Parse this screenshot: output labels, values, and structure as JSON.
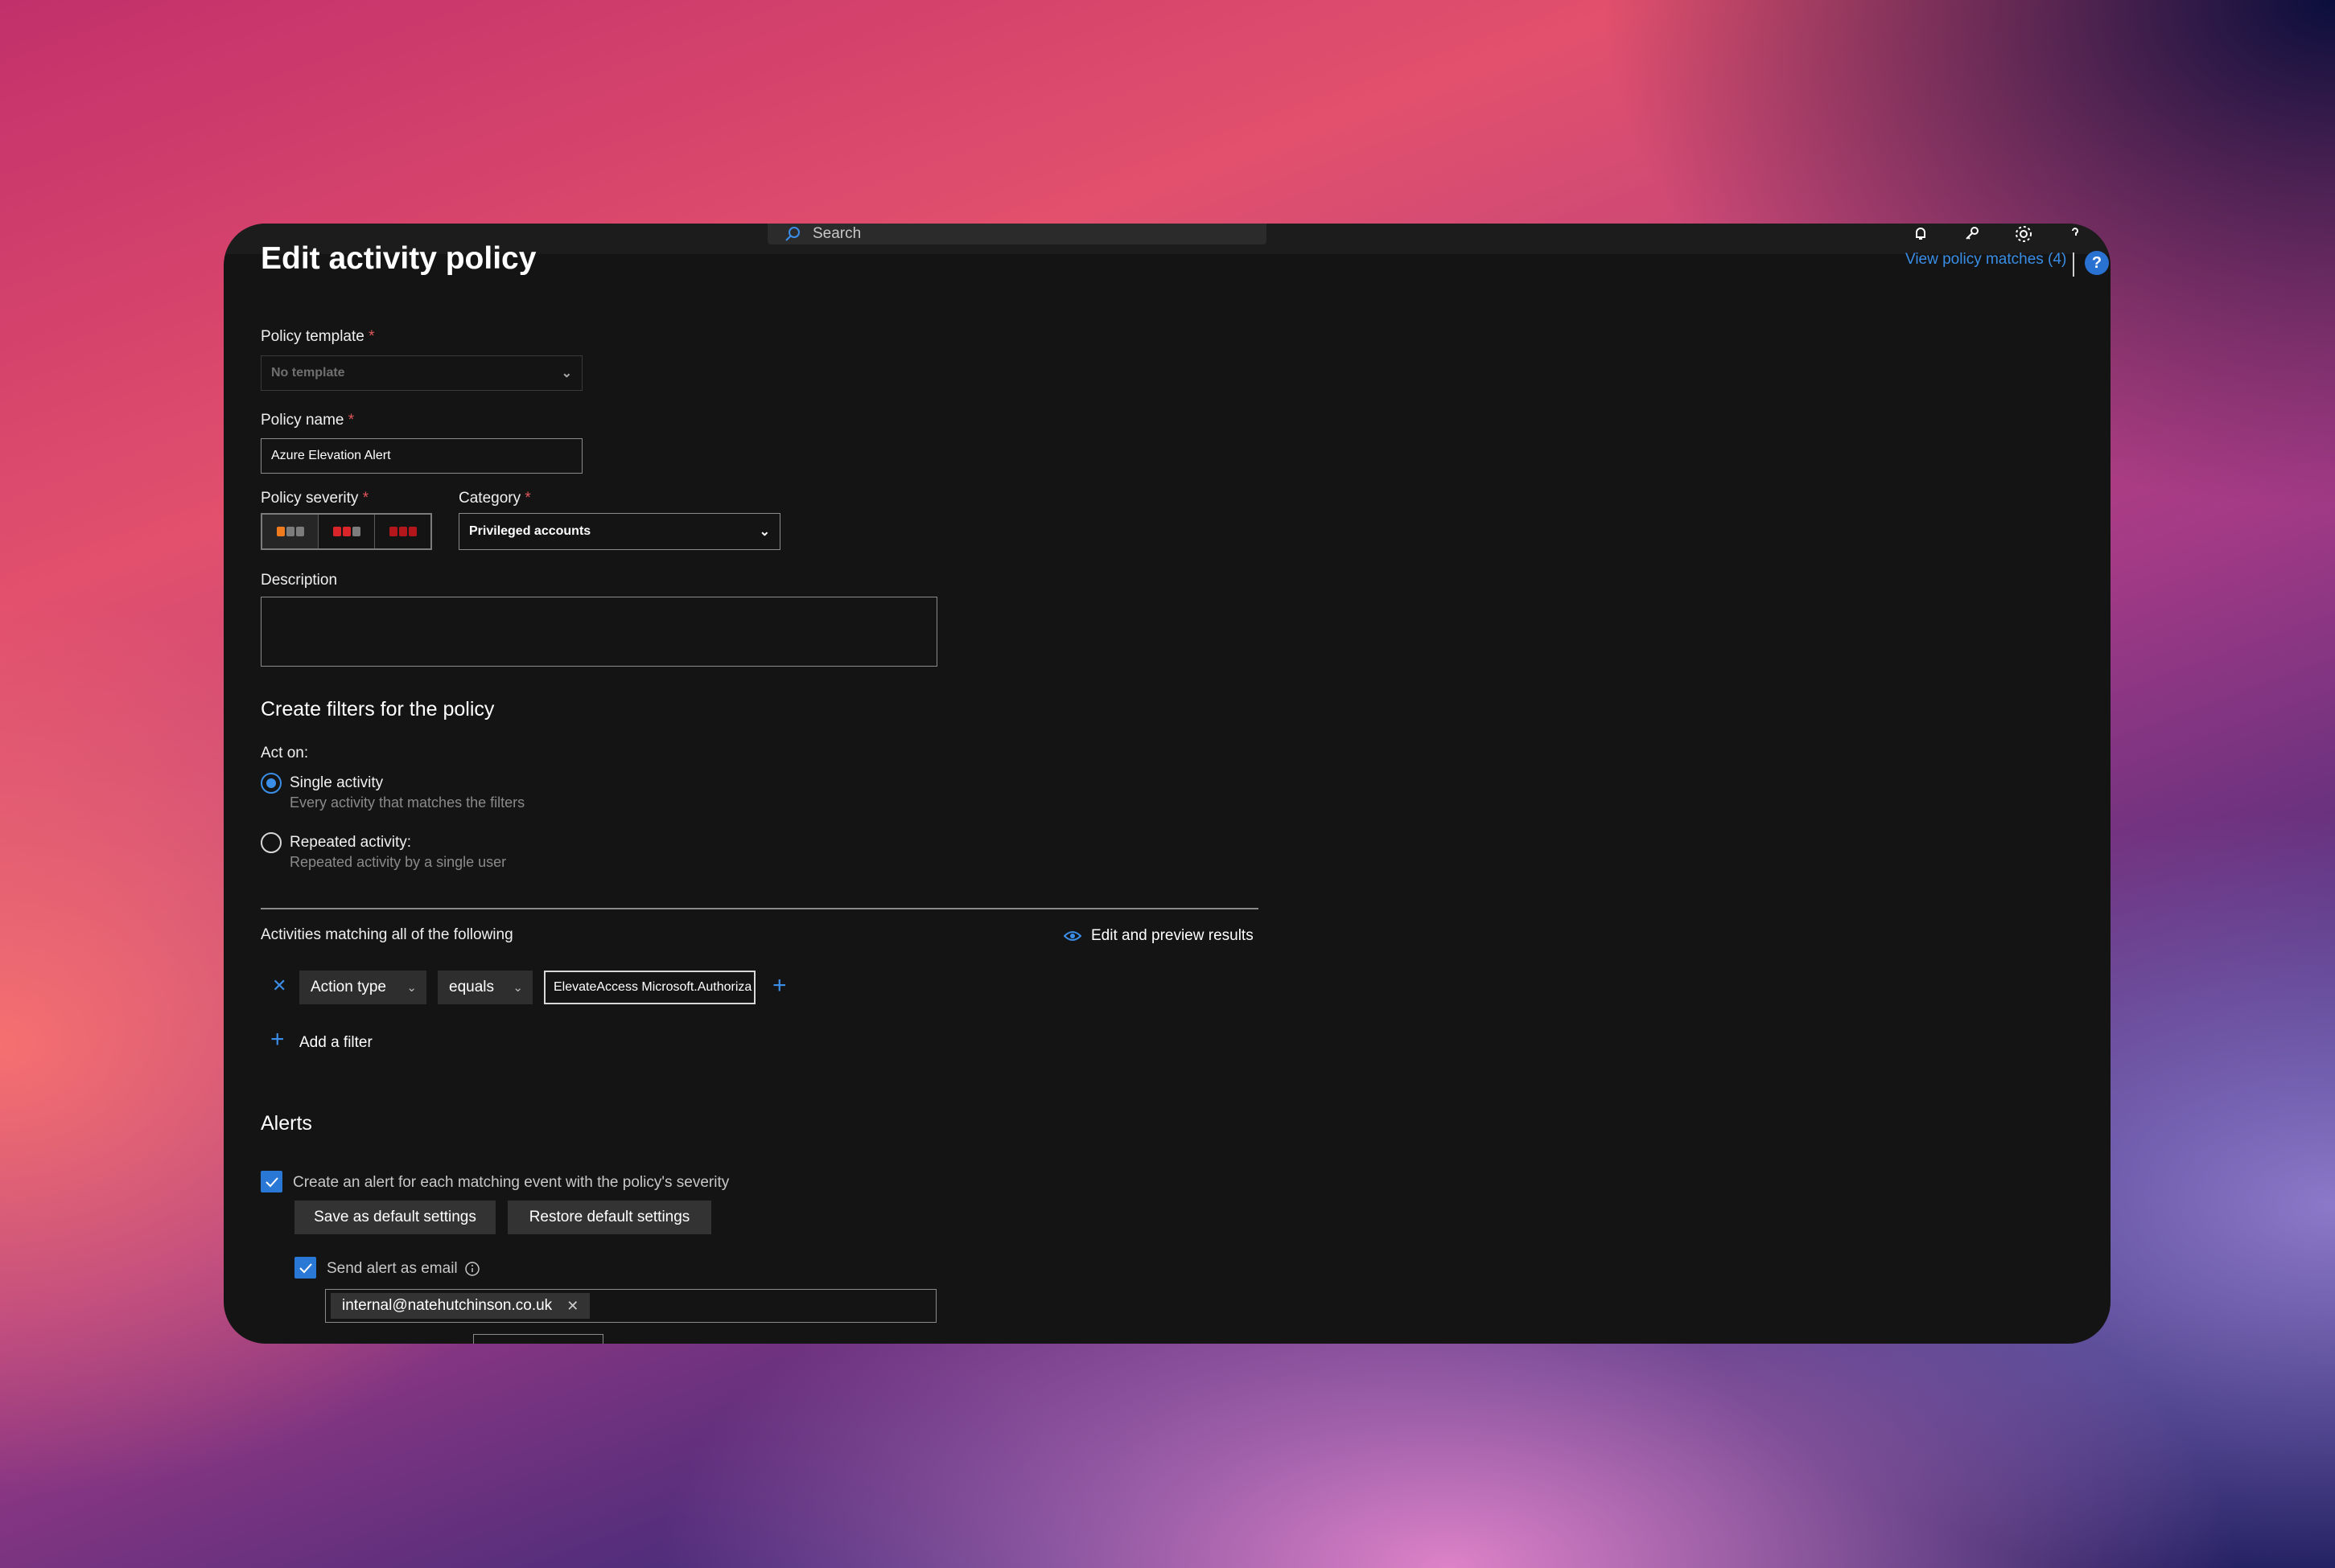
{
  "header": {
    "search_placeholder": "Search",
    "view_matches": "View policy matches (4)",
    "help": "?"
  },
  "page": {
    "title": "Edit activity policy"
  },
  "form": {
    "template": {
      "label": "Policy template",
      "required": "*",
      "value": "No template"
    },
    "name": {
      "label": "Policy name",
      "required": "*",
      "value": "Azure Elevation Alert"
    },
    "severity": {
      "label": "Policy severity",
      "required": "*",
      "options": [
        "low",
        "medium",
        "high"
      ],
      "selected": "low",
      "colors": {
        "low_on": "#f07a1e",
        "low_off": "#7c7c7c",
        "medium": "#d9242a",
        "high": "#b3171c"
      }
    },
    "category": {
      "label": "Category",
      "required": "*",
      "value": "Privileged accounts"
    },
    "description": {
      "label": "Description",
      "value": ""
    }
  },
  "filters": {
    "heading": "Create filters for the policy",
    "act_on_label": "Act on:",
    "single": {
      "title": "Single activity",
      "subtitle": "Every activity that matches the filters",
      "selected": true
    },
    "repeated": {
      "title": "Repeated activity:",
      "subtitle": "Repeated activity by a single user",
      "selected": false
    },
    "matching_label": "Activities matching all of the following",
    "edit_preview": "Edit and preview results",
    "rule": {
      "field": "Action type",
      "operator": "equals",
      "value": "ElevateAccess Microsoft.Authoriza"
    },
    "add_filter": "Add a filter"
  },
  "alerts": {
    "heading": "Alerts",
    "create_alert": {
      "label": "Create an alert for each matching event with the policy's severity",
      "checked": true
    },
    "save_default": "Save as default settings",
    "restore_default": "Restore default settings",
    "send_email": {
      "label": "Send alert as email",
      "checked": true
    },
    "email": "internal@natehutchinson.co.uk"
  },
  "colors": {
    "accent": "#3b8ee8",
    "window_bg": "#141414",
    "required": "#e0565a"
  }
}
